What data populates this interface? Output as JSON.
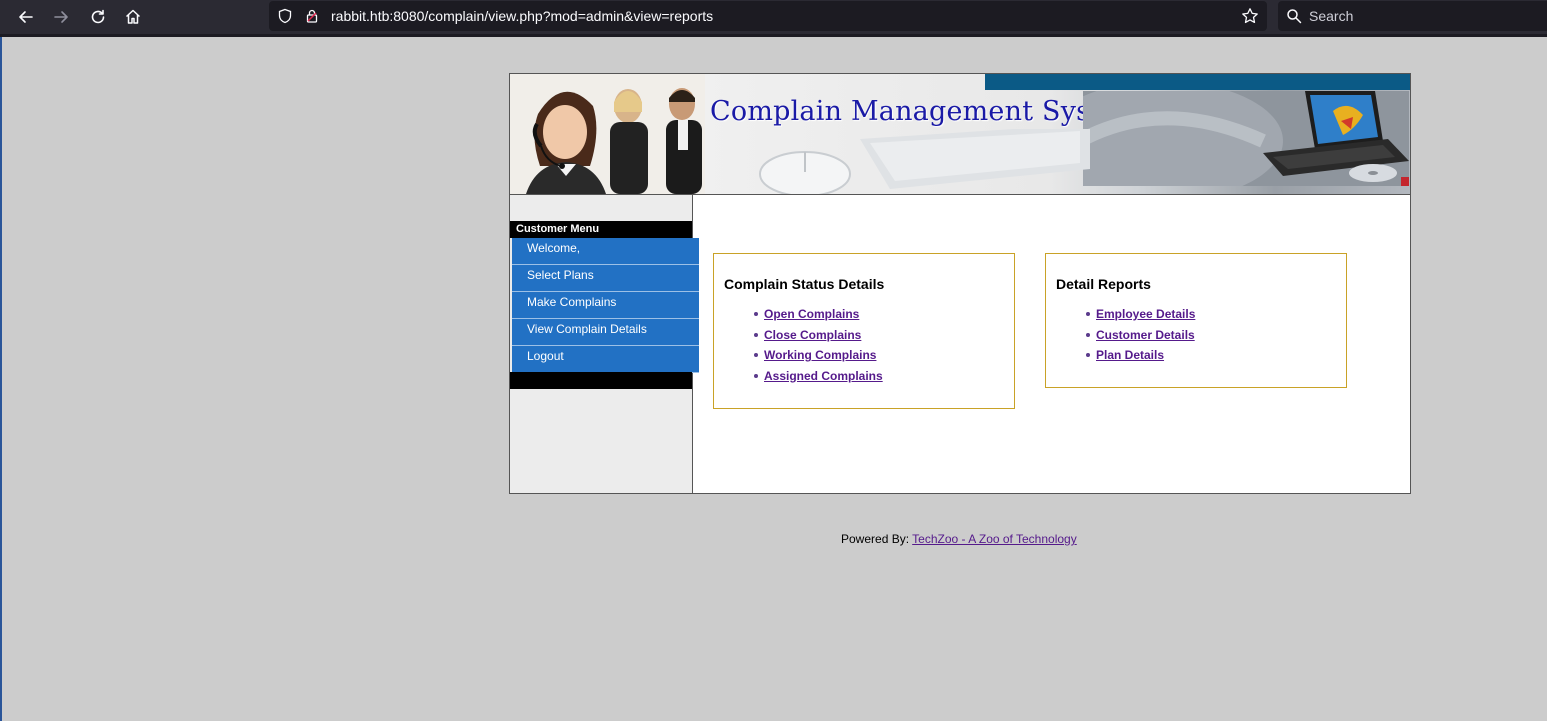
{
  "browser": {
    "url": "rabbit.htb:8080/complain/view.php?mod=admin&view=reports",
    "search_placeholder": "Search",
    "icons": [
      "back-arrow-icon",
      "forward-arrow-icon",
      "reload-icon",
      "home-icon",
      "shield-icon",
      "lock-icon",
      "bookmark-star-icon",
      "search-icon"
    ]
  },
  "header": {
    "title": "Complain Management System"
  },
  "sidebar": {
    "heading": "Customer Menu",
    "items": [
      {
        "label": "Welcome,"
      },
      {
        "label": "Select Plans"
      },
      {
        "label": "Make Complains"
      },
      {
        "label": "View Complain Details"
      },
      {
        "label": "Logout"
      }
    ]
  },
  "complain_status": {
    "title": "Complain Status Details",
    "links": [
      {
        "label": "Open Complains"
      },
      {
        "label": "Close Complains"
      },
      {
        "label": "Working Complains"
      },
      {
        "label": "Assigned Complains"
      }
    ]
  },
  "detail_reports": {
    "title": "Detail Reports",
    "links": [
      {
        "label": "Employee Details"
      },
      {
        "label": "Customer Details"
      },
      {
        "label": "Plan Details"
      }
    ]
  },
  "footer": {
    "prefix": "Powered By:",
    "link": "TechZoo - A Zoo of Technology"
  },
  "colors": {
    "menu_blue": "#2271c4",
    "box_border": "#c9a227",
    "link_purple": "#551a8b",
    "banner_title": "#1a1aa6"
  }
}
